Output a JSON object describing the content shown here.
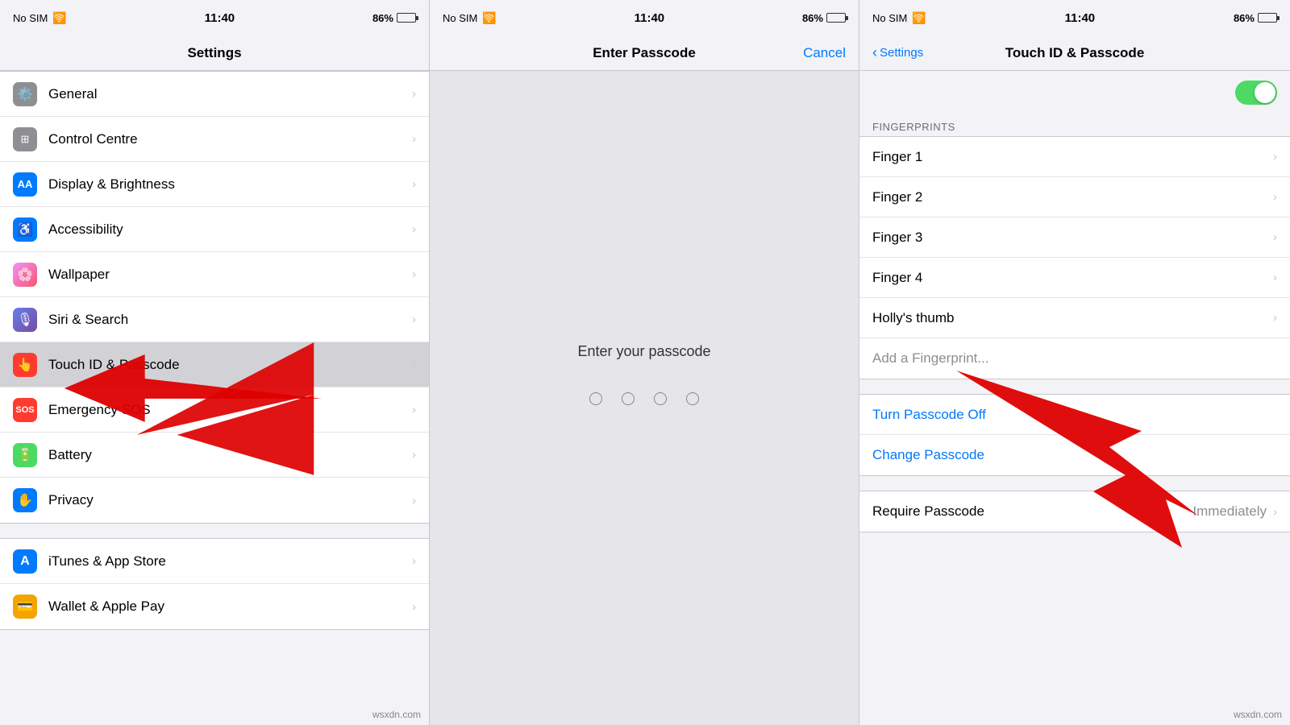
{
  "panels": {
    "panel1": {
      "statusBar": {
        "simText": "No SIM",
        "wifiIcon": "📶",
        "time": "11:40",
        "battery": "86%"
      },
      "navTitle": "Settings",
      "rows": [
        {
          "id": "general",
          "icon": "⚙️",
          "iconBg": "#8e8e93",
          "label": "General"
        },
        {
          "id": "control-centre",
          "icon": "⚙️",
          "iconBg": "#8e8e93",
          "label": "Control Centre"
        },
        {
          "id": "display-brightness",
          "icon": "AA",
          "iconBg": "#007aff",
          "label": "Display & Brightness"
        },
        {
          "id": "accessibility",
          "icon": "♿",
          "iconBg": "#007aff",
          "label": "Accessibility"
        },
        {
          "id": "wallpaper",
          "icon": "🌸",
          "iconBg": "#ff6b6b",
          "label": "Wallpaper"
        },
        {
          "id": "siri-search",
          "icon": "🎙",
          "iconBg": "#f0a030",
          "label": "Siri & Search"
        },
        {
          "id": "touch-id-passcode",
          "icon": "👆",
          "iconBg": "#ff3b30",
          "label": "Touch ID & Passcode",
          "active": true
        },
        {
          "id": "emergency-sos",
          "icon": "SOS",
          "iconBg": "#ff3b30",
          "label": "Emergency SOS"
        },
        {
          "id": "battery",
          "icon": "🔋",
          "iconBg": "#4cd964",
          "label": "Battery"
        },
        {
          "id": "privacy",
          "icon": "✋",
          "iconBg": "#007aff",
          "label": "Privacy"
        }
      ],
      "rows2": [
        {
          "id": "itunes-app-store",
          "icon": "A",
          "iconBg": "#007aff",
          "label": "iTunes & App Store"
        },
        {
          "id": "wallet-apple-pay",
          "icon": "💳",
          "iconBg": "#f4a400",
          "label": "Wallet & Apple Pay"
        }
      ]
    },
    "panel2": {
      "statusBar": {
        "simText": "No SIM",
        "time": "11:40",
        "battery": "86%"
      },
      "navTitle": "Enter Passcode",
      "cancelLabel": "Cancel",
      "prompt": "Enter your passcode",
      "dots": 4
    },
    "panel3": {
      "statusBar": {
        "simText": "No SIM",
        "time": "11:40",
        "battery": "86%"
      },
      "backLabel": "Settings",
      "navTitle": "Touch ID & Passcode",
      "sectionFingerprints": "FINGERPRINTS",
      "fingers": [
        {
          "id": "finger-1",
          "label": "Finger 1"
        },
        {
          "id": "finger-2",
          "label": "Finger 2"
        },
        {
          "id": "finger-3",
          "label": "Finger 3"
        },
        {
          "id": "finger-4",
          "label": "Finger 4"
        },
        {
          "id": "hollys-thumb",
          "label": "Holly's thumb"
        }
      ],
      "addFingerprint": "Add a Fingerprint...",
      "turnPasscodeOff": "Turn Passcode Off",
      "changePasscode": "Change Passcode",
      "requirePasscodeLabel": "Require Passcode",
      "requirePasscodeValue": "Immediately"
    }
  },
  "watermark": "wsxdn.com"
}
